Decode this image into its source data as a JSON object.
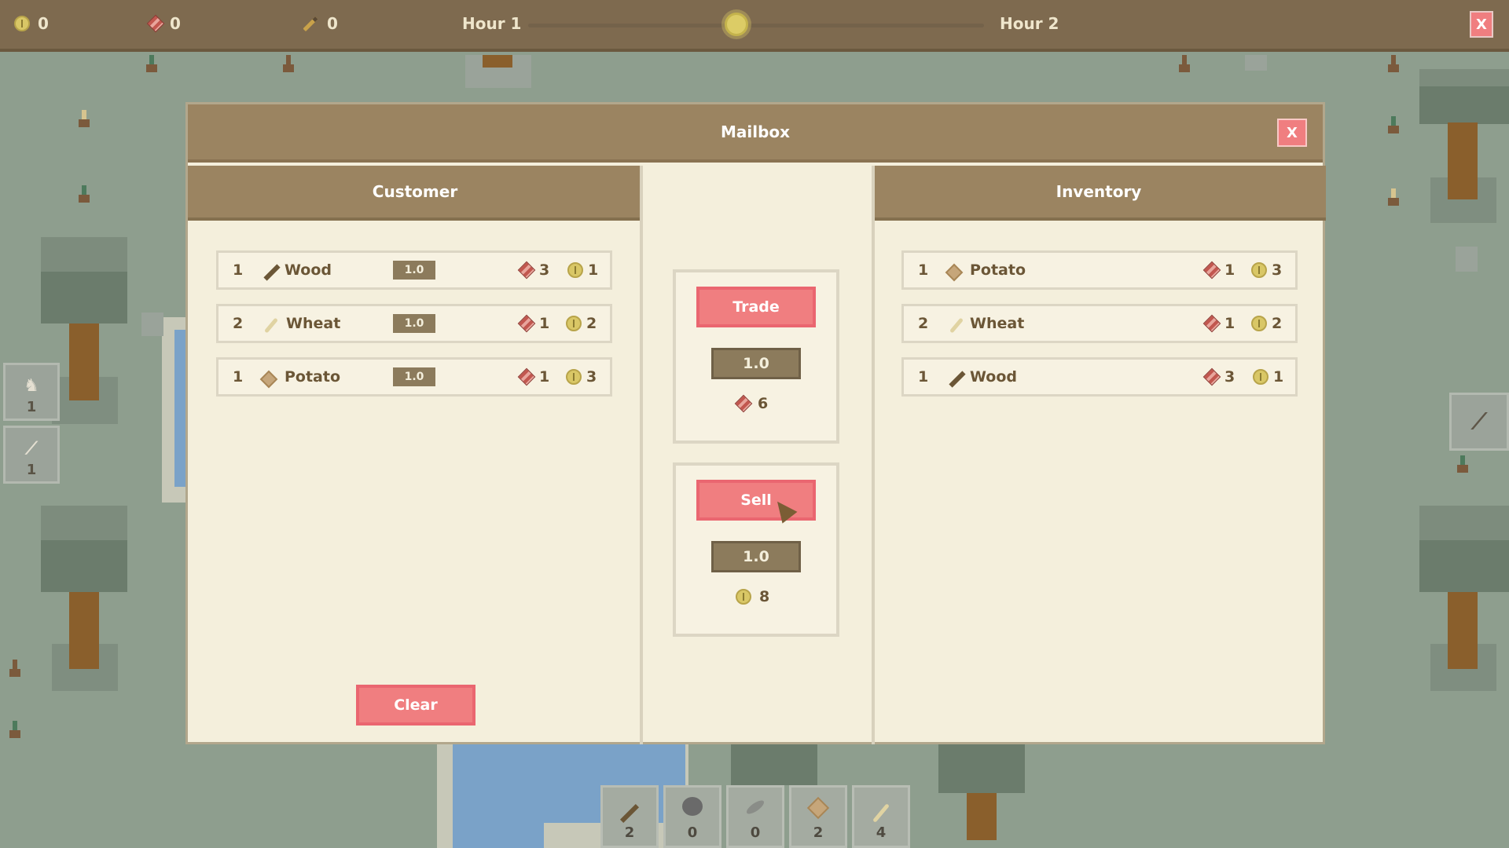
{
  "topbar": {
    "coins": "0",
    "gems": "0",
    "tools": "0",
    "hour_start": "Hour 1",
    "hour_end": "Hour 2",
    "close_label": "X"
  },
  "side_slots": [
    {
      "icon": "rabbit-icon",
      "count": "1"
    },
    {
      "icon": "wheat-icon",
      "count": "1"
    }
  ],
  "right_slot": {
    "icon": "sickle-icon"
  },
  "dialog": {
    "title": "Mailbox",
    "close_label": "X",
    "customer_header": "Customer",
    "inventory_header": "Inventory",
    "customer_items": [
      {
        "qty": "1",
        "icon": "wood-icon",
        "name": "Wood",
        "mult": "1.0",
        "gems": "3",
        "coins": "1"
      },
      {
        "qty": "2",
        "icon": "wheat-icon",
        "name": "Wheat",
        "mult": "1.0",
        "gems": "1",
        "coins": "2"
      },
      {
        "qty": "1",
        "icon": "potato-icon",
        "name": "Potato",
        "mult": "1.0",
        "gems": "1",
        "coins": "3"
      }
    ],
    "inventory_items": [
      {
        "qty": "1",
        "icon": "potato-icon",
        "name": "Potato",
        "gems": "1",
        "coins": "3"
      },
      {
        "qty": "2",
        "icon": "wheat-icon",
        "name": "Wheat",
        "gems": "1",
        "coins": "2"
      },
      {
        "qty": "1",
        "icon": "wood-icon",
        "name": "Wood",
        "gems": "3",
        "coins": "1"
      }
    ],
    "trade": {
      "label": "Trade",
      "multiplier": "1.0",
      "total_gems": "6"
    },
    "sell": {
      "label": "Sell",
      "multiplier": "1.0",
      "total_coins": "8"
    },
    "clear_label": "Clear"
  },
  "hotbar": [
    {
      "icon": "wood-icon",
      "count": "2"
    },
    {
      "icon": "stone-icon",
      "count": "0"
    },
    {
      "icon": "fish-icon",
      "count": "0"
    },
    {
      "icon": "potato-icon",
      "count": "2"
    },
    {
      "icon": "wheat-icon",
      "count": "4"
    }
  ],
  "colors": {
    "accent_pink": "#f07e80",
    "header_brown": "#9b8461",
    "panel_cream": "#f4efdc",
    "grass": "#8e9e8e"
  }
}
